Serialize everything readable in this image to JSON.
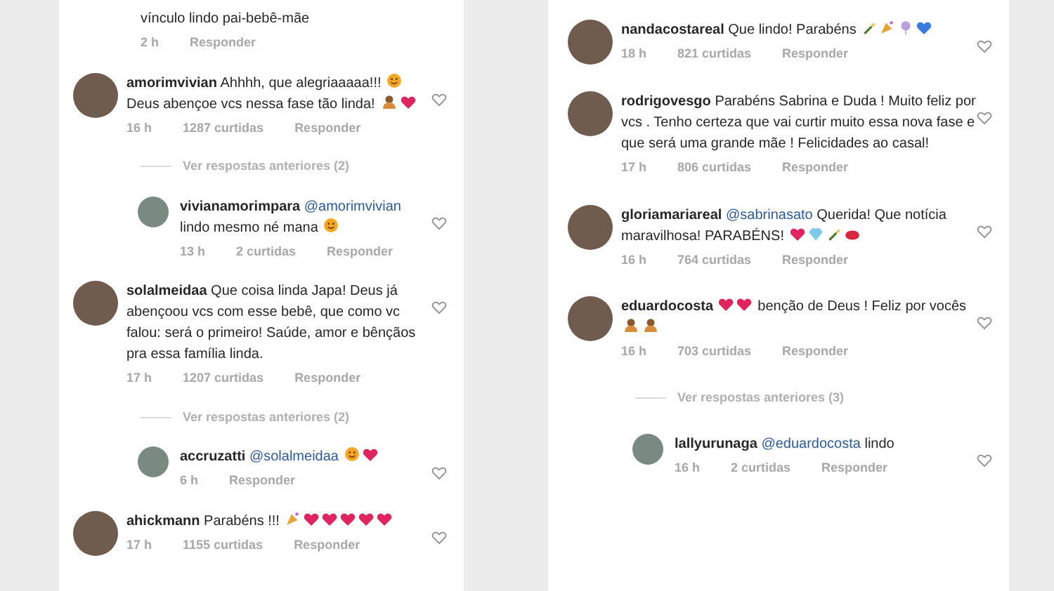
{
  "panels": [
    {
      "items": [
        {
          "kind": "tail",
          "text": "vínculo lindo pai-bebê-mãe",
          "time": "2 h",
          "reply_label": "Responder"
        },
        {
          "kind": "comment",
          "user": "amorimvivian",
          "text": "Ahhhh, que alegriaaaaa!!!",
          "emojis_mid": [
            {
              "kind": "face"
            }
          ],
          "text2": "Deus abençoe vcs nessa fase tão linda!",
          "emojis": [
            {
              "kind": "hands"
            },
            {
              "kind": "heart"
            }
          ],
          "time": "16 h",
          "likes": "1287 curtidas",
          "reply_label": "Responder"
        },
        {
          "kind": "more",
          "text": "Ver respostas anteriores (2)"
        },
        {
          "kind": "reply",
          "user": "vivianamorimpara",
          "mention": "@amorimvivian",
          "text": "lindo mesmo né mana",
          "emojis": [
            {
              "kind": "face"
            }
          ],
          "time": "13 h",
          "likes": "2 curtidas",
          "reply_label": "Responder"
        },
        {
          "kind": "comment",
          "user": "solalmeidaa",
          "text": "Que coisa linda Japa! Deus já abençoou vcs com esse bebê, que como vc falou: será o primeiro! Saúde, amor e bênçãos pra essa família linda.",
          "time": "17 h",
          "likes": "1207 curtidas",
          "reply_label": "Responder"
        },
        {
          "kind": "more",
          "text": "Ver respostas anteriores (2)"
        },
        {
          "kind": "reply",
          "user": "accruzatti",
          "mention": "@solalmeidaa",
          "emojis": [
            {
              "kind": "face"
            },
            {
              "kind": "heart"
            }
          ],
          "time": "6 h",
          "reply_label": "Responder"
        },
        {
          "kind": "comment",
          "user": "ahickmann",
          "text": "Parabéns !!!",
          "emojis": [
            {
              "kind": "party"
            },
            {
              "kind": "heart"
            },
            {
              "kind": "heart"
            },
            {
              "kind": "heart"
            },
            {
              "kind": "heart"
            },
            {
              "kind": "heart"
            }
          ],
          "time": "17 h",
          "likes": "1155 curtidas",
          "reply_label": "Responder"
        }
      ]
    },
    {
      "items": [
        {
          "kind": "comment",
          "user": "nandacostareal",
          "text": "Que lindo! Parabéns",
          "emojis": [
            {
              "kind": "bottle"
            },
            {
              "kind": "party"
            },
            {
              "kind": "balloon"
            },
            {
              "kind": "blueheart"
            }
          ],
          "time": "18 h",
          "likes": "821 curtidas",
          "reply_label": "Responder"
        },
        {
          "kind": "comment",
          "user": "rodrigovesgo",
          "text": "Parabéns Sabrina e Duda ! Muito feliz por vcs . Tenho certeza que vai curtir muito essa nova fase e que será uma grande mãe ! Felicidades ao casal!",
          "time": "17 h",
          "likes": "806 curtidas",
          "reply_label": "Responder"
        },
        {
          "kind": "comment",
          "user": "gloriamariareal",
          "mention": "@sabrinasato",
          "text": "Querida! Que notícia maravilhosa! PARABÉNS!",
          "emojis": [
            {
              "kind": "heart"
            },
            {
              "kind": "diamond"
            },
            {
              "kind": "bottle"
            },
            {
              "kind": "lips"
            }
          ],
          "time": "16 h",
          "likes": "764 curtidas",
          "reply_label": "Responder"
        },
        {
          "kind": "comment",
          "user": "eduardocosta",
          "emojis_mid": [
            {
              "kind": "heart"
            },
            {
              "kind": "heart"
            }
          ],
          "text2": "benção de Deus ! Feliz por vocês",
          "emojis": [
            {
              "kind": "hands"
            },
            {
              "kind": "hands"
            }
          ],
          "time": "16 h",
          "likes": "703 curtidas",
          "reply_label": "Responder"
        },
        {
          "kind": "more",
          "text": "Ver respostas anteriores (3)"
        },
        {
          "kind": "reply",
          "user": "lallyurunaga",
          "mention": "@eduardocosta",
          "text": "lindo",
          "time": "16 h",
          "likes": "2 curtidas",
          "reply_label": "Responder"
        }
      ]
    }
  ]
}
